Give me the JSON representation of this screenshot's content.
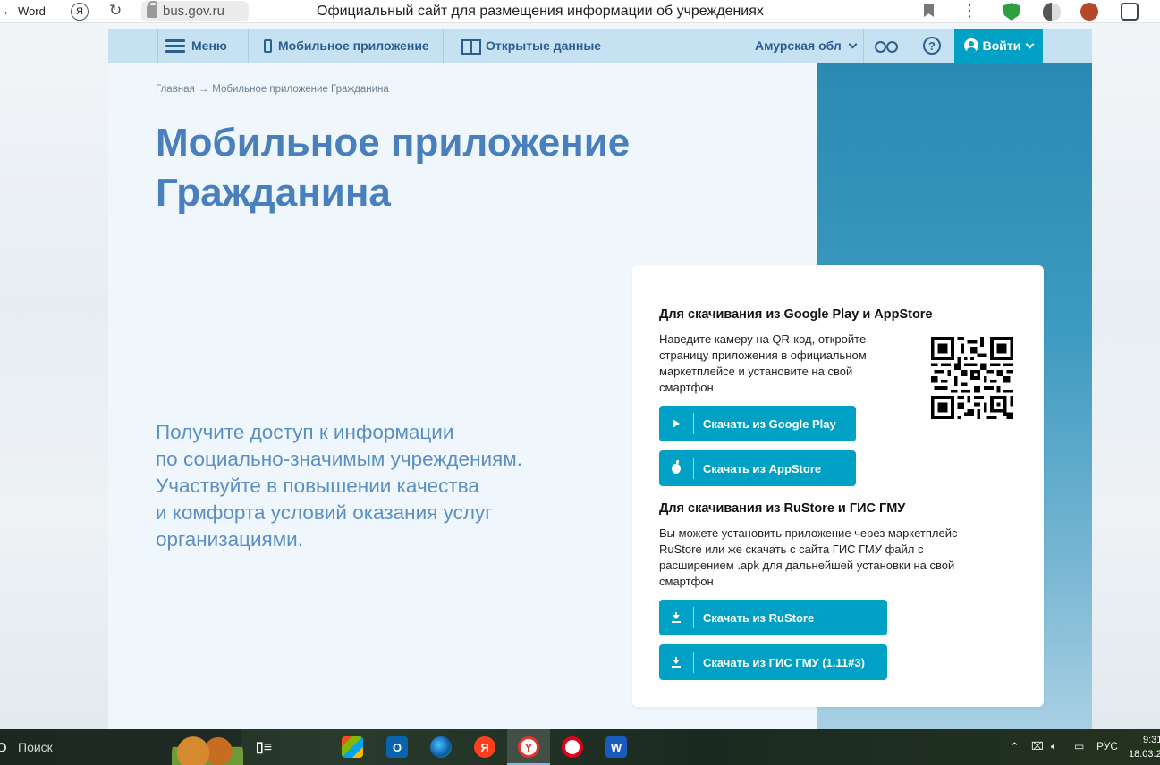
{
  "browser": {
    "back_label": "Word",
    "ya_label": "Я",
    "url": "bus.gov.ru",
    "title": "Официальный сайт для размещения информации об учреждениях"
  },
  "nav": {
    "menu": "Меню",
    "mobile_app": "Мобильное приложение",
    "open_data": "Открытые данные",
    "region": "Амурская обл",
    "help": "?",
    "login": "Войти"
  },
  "breadcrumb": {
    "home": "Главная",
    "separator": "→",
    "current": "Мобильное приложение Гражданина"
  },
  "hero": {
    "title_line1": "Мобильное приложение",
    "title_line2": "Гражданина",
    "lead_lines": [
      "Получите доступ к информации",
      "по социально-значимым учреждениям.",
      "Участвуйте в повышении качества",
      "и комфорта условий оказания услуг",
      "организациями."
    ]
  },
  "card": {
    "section1": {
      "heading": "Для скачивания из Google Play и AppStore",
      "text_lines": [
        "Наведите камеру на QR-код, откройте",
        "страницу приложения в официальном",
        "маркетплейсе и установите на свой",
        "смартфон"
      ],
      "google_play": "Скачать из Google Play",
      "app_store": "Скачать из AppStore"
    },
    "section2": {
      "heading": "Для скачивания из RuStore и ГИС ГМУ",
      "text_lines": [
        "Вы можете установить приложение через маркетплейс",
        "RuStore или же скачать с сайта ГИС ГМУ файл с",
        "расширением .apk для дальнейшей установки на свой",
        "смартфон"
      ],
      "rustore": "Скачать из RuStore",
      "gis_gmu": "Скачать из ГИС ГМУ (1.11#3)"
    }
  },
  "taskbar": {
    "search_placeholder": "Поиск",
    "yandex_label": "Я",
    "opera_label": "O",
    "word_label": "W",
    "outlook_label": "O",
    "language": "РУС",
    "time": "9:31",
    "date": "18.03.2"
  },
  "colors": {
    "accent": "#00a1c5",
    "nav_bg": "#c5e1f2",
    "title": "#4a7fbd",
    "side_panel": "#2a8ab2"
  }
}
